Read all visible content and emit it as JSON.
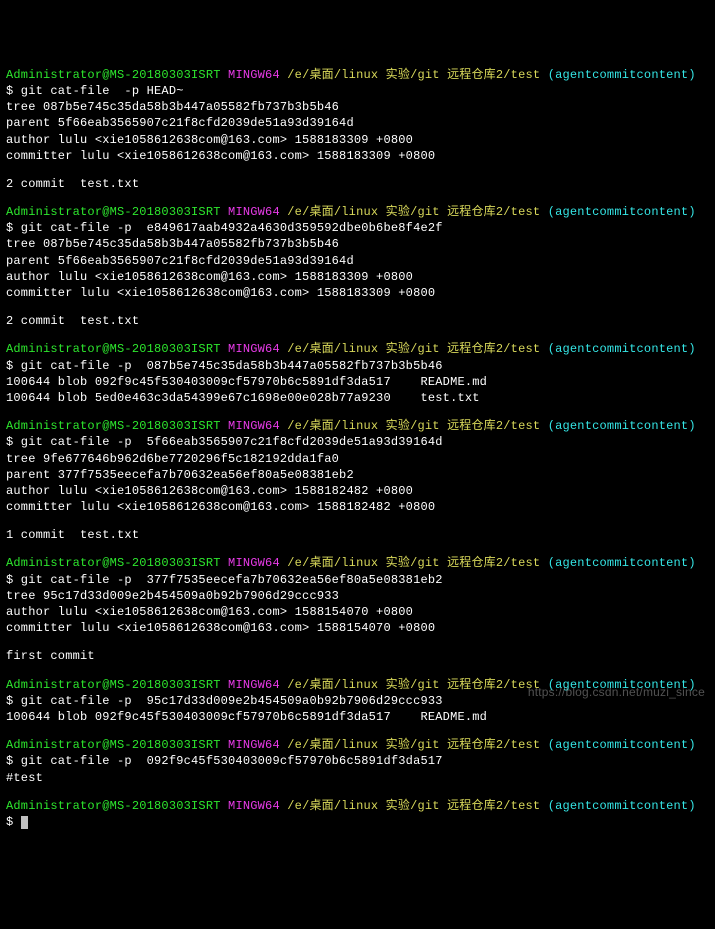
{
  "prompt": {
    "user_host": "Administrator@MS-20180303ISRT",
    "mingw": "MINGW64",
    "path": "/e/桌面/linux 实验/git 远程仓库2/test",
    "branch": "(agentcommitcontent)",
    "path_truncated": "/e/桌面/linux 实验/git 远程仓库2/test (agentcommitcontent)"
  },
  "blocks": [
    {
      "cmd": "$ git cat-file  -p HEAD~",
      "out": [
        "tree 087b5e745c35da58b3b447a05582fb737b3b5b46",
        "parent 5f66eab3565907c21f8cfd2039de51a93d39164d",
        "author lulu <xie1058612638com@163.com> 1588183309 +0800",
        "committer lulu <xie1058612638com@163.com> 1588183309 +0800",
        "",
        "2 commit  test.txt",
        ""
      ]
    },
    {
      "cmd": "$ git cat-file -p  e849617aab4932a4630d359592dbe0b6be8f4e2f",
      "out": [
        "tree 087b5e745c35da58b3b447a05582fb737b3b5b46",
        "parent 5f66eab3565907c21f8cfd2039de51a93d39164d",
        "author lulu <xie1058612638com@163.com> 1588183309 +0800",
        "committer lulu <xie1058612638com@163.com> 1588183309 +0800",
        "",
        "2 commit  test.txt",
        ""
      ]
    },
    {
      "cmd": "$ git cat-file -p  087b5e745c35da58b3b447a05582fb737b3b5b46",
      "out": [
        "100644 blob 092f9c45f530403009cf57970b6c5891df3da517    README.md",
        "100644 blob 5ed0e463c3da54399e67c1698e00e028b77a9230    test.txt",
        ""
      ]
    },
    {
      "cmd": "$ git cat-file -p  5f66eab3565907c21f8cfd2039de51a93d39164d",
      "out": [
        "tree 9fe677646b962d6be7720296f5c182192dda1fa0",
        "parent 377f7535eecefa7b70632ea56ef80a5e08381eb2",
        "author lulu <xie1058612638com@163.com> 1588182482 +0800",
        "committer lulu <xie1058612638com@163.com> 1588182482 +0800",
        "",
        "1 commit  test.txt",
        ""
      ]
    },
    {
      "cmd": "$ git cat-file -p  377f7535eecefa7b70632ea56ef80a5e08381eb2",
      "out": [
        "tree 95c17d33d009e2b454509a0b92b7906d29ccc933",
        "author lulu <xie1058612638com@163.com> 1588154070 +0800",
        "committer lulu <xie1058612638com@163.com> 1588154070 +0800",
        "",
        "first commit",
        ""
      ]
    },
    {
      "cmd": "$ git cat-file -p  95c17d33d009e2b454509a0b92b7906d29ccc933",
      "out": [
        "100644 blob 092f9c45f530403009cf57970b6c5891df3da517    README.md",
        ""
      ]
    },
    {
      "cmd": "$ git cat-file -p  092f9c45f530403009cf57970b6c5891df3da517",
      "out": [
        "#test",
        ""
      ]
    }
  ],
  "final_cmd": "$ ",
  "watermark": "https://blog.csdn.net/muzi_since"
}
